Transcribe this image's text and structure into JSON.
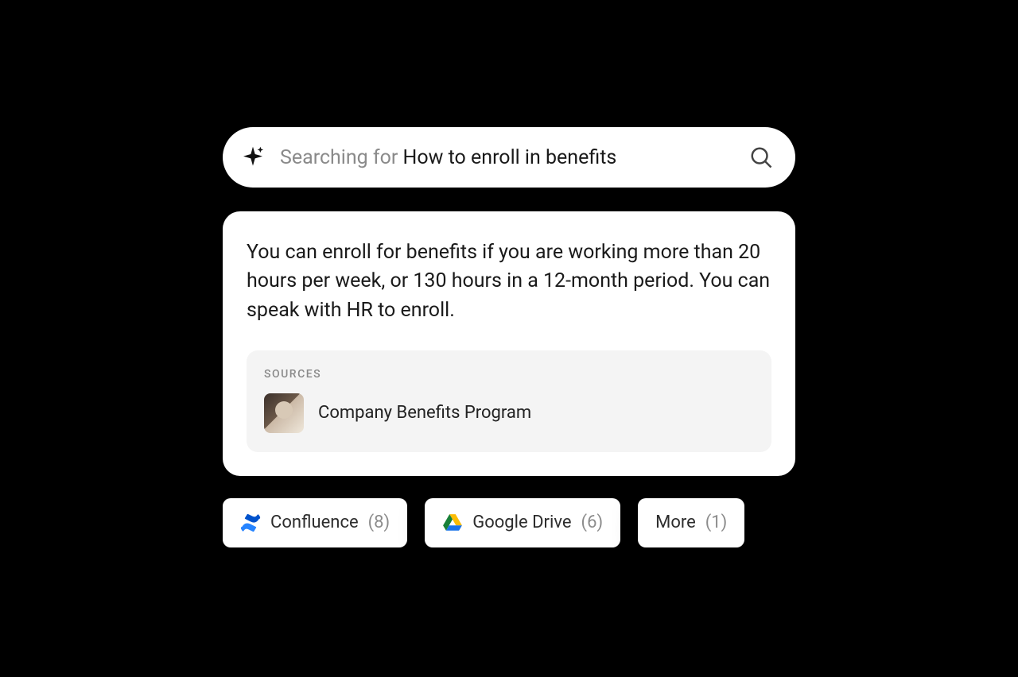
{
  "search": {
    "prefix": "Searching for ",
    "query": "How to enroll in benefits"
  },
  "answer": {
    "text": "You can enroll for benefits if you are working more than 20 hours per week, or 130 hours in a 12-month period. You can speak with HR to enroll."
  },
  "sources": {
    "heading": "SOURCES",
    "items": [
      {
        "title": "Company Benefits Program"
      }
    ]
  },
  "chips": [
    {
      "icon": "confluence",
      "label": "Confluence",
      "count": "(8)"
    },
    {
      "icon": "gdrive",
      "label": "Google Drive",
      "count": "(6)"
    },
    {
      "icon": "",
      "label": "More",
      "count": "(1)"
    }
  ]
}
